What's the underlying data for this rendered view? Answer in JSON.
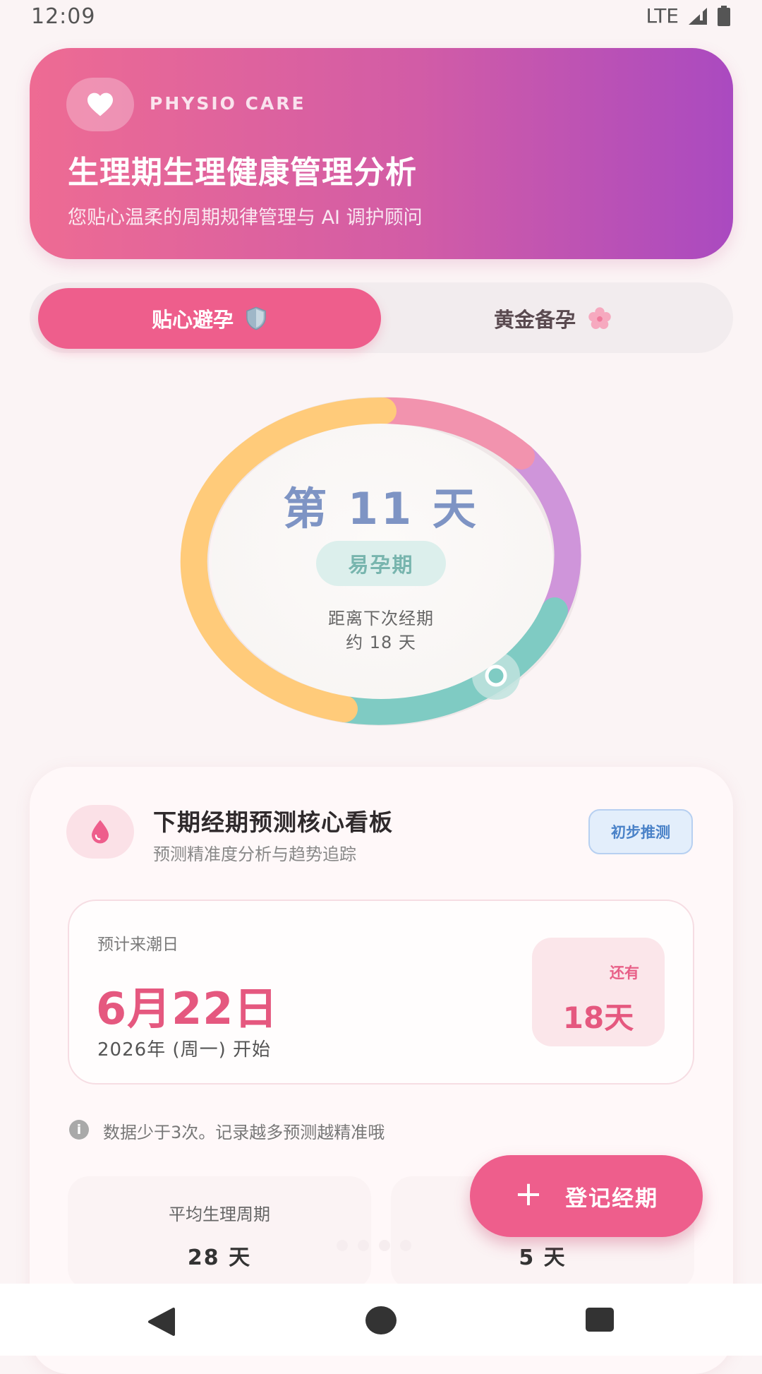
{
  "status_bar": {
    "time": "12:09",
    "network": "LTE"
  },
  "header": {
    "brand": "PHYSIO CARE",
    "title": "生理期生理健康管理分析",
    "subtitle": "您贴心温柔的周期规律管理与 AI 调护顾问",
    "icon": "heart-icon"
  },
  "mode_tabs": [
    {
      "label": "贴心避孕",
      "icon": "shield-icon",
      "active": true
    },
    {
      "label": "黄金备孕",
      "icon": "flower-icon",
      "active": false
    }
  ],
  "cycle_ring": {
    "day_text": "第 11 天",
    "phase": "易孕期",
    "next_period_line1": "距离下次经期",
    "next_period_line2": "约 18 天",
    "current_day": 11,
    "cycle_length": 28,
    "colors": {
      "menstrual": "#F293AE",
      "follicular": "#FFCB7A",
      "fertile": "#7FCBC3",
      "luteal": "#CF95DA"
    }
  },
  "prediction_card": {
    "title": "下期经期预测核心看板",
    "subtitle": "预测精准度分析与趋势追踪",
    "tag": "初步推测",
    "icon": "drop-icon",
    "expected_label": "预计来潮日",
    "expected_date": "6月22日",
    "expected_year": "2026年 (周一) 开始",
    "remaining_label": "还有",
    "remaining_value": "18天",
    "note": "数据少于3次。记录越多预测越精准哦",
    "note_icon": "info-icon",
    "stats": [
      {
        "label": "平均生理周期",
        "value": "28 天"
      },
      {
        "label": "",
        "value": "5 天"
      }
    ]
  },
  "fab": {
    "label": "登记经期",
    "icon": "plus-icon"
  },
  "accent_color": "#EE5E8C"
}
